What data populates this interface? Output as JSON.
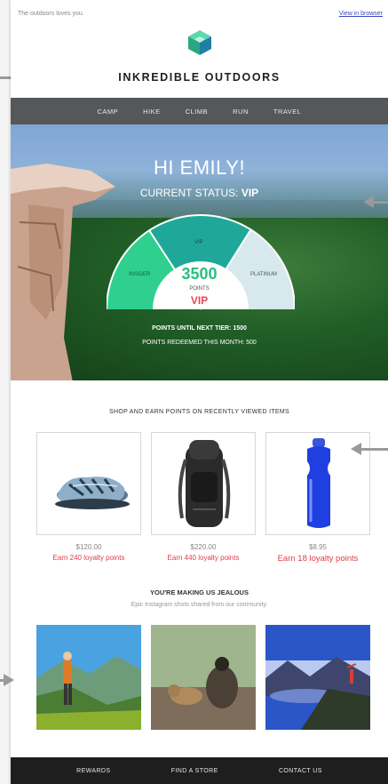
{
  "preheader": {
    "tagline": "The outdoors loves you.",
    "view_in_browser": "View in browser"
  },
  "brand": {
    "name": "INKREDIBLE OUTDOORS",
    "accent": "#2fbf8e"
  },
  "nav": {
    "items": [
      "CAMP",
      "HIKE",
      "CLIMB",
      "RUN",
      "TRAVEL"
    ]
  },
  "hero": {
    "greeting": "HI EMILY!",
    "status_label": "CURRENT STATUS:",
    "status_value": "VIP",
    "gauge": {
      "tiers": [
        "INSIDER",
        "VIP",
        "PLATINUM"
      ],
      "points": "3500",
      "points_label": "POINTS",
      "current_tier": "VIP"
    },
    "points_until_next": "POINTS UNTIL NEXT TIER: 1500",
    "points_redeemed": "POINTS REDEEMED THIS MONTH: 500"
  },
  "shop": {
    "title": "SHOP AND EARN POINTS ON RECENTLY VIEWED ITEMS",
    "products": [
      {
        "name": "sandal",
        "price": "$120.00",
        "earn": "Earn 240 loyalty points"
      },
      {
        "name": "backpack",
        "price": "$220.00",
        "earn": "Earn 440 loyalty points"
      },
      {
        "name": "water-bottle",
        "price": "$8.95",
        "earn": "Earn 18 loyalty points"
      }
    ]
  },
  "community": {
    "title": "YOU'RE MAKING US JEALOUS",
    "subtitle": "Epic Instagram shots shared from our community."
  },
  "footer": {
    "items": [
      "REWARDS",
      "FIND A STORE",
      "CONTACT US"
    ]
  },
  "colors": {
    "nav_bg": "#555759",
    "footer_bg": "#1e1e1e",
    "earn_red": "#e03c4b",
    "points_green": "#27c07f"
  }
}
